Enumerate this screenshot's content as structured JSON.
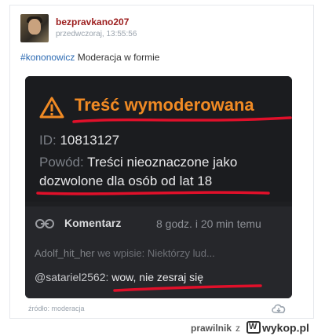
{
  "post": {
    "username": "bezpravkano207",
    "timestamp": "przedwczoraj, 13:55:56",
    "hash": "#",
    "tag": "kononowicz",
    "text": " Moderacja w formie"
  },
  "embed": {
    "title": "Treść wymoderowana",
    "id_label": "ID: ",
    "id_value": "10813127",
    "reason_label": "Powód: ",
    "reason_value_line1": "Treści nieoznaczone jako",
    "reason_value_line2": "dozwolone dla osób od lat 18",
    "comment_label": "Komentarz",
    "comment_time": "8 godz. i 20 min temu",
    "faded_user": "Adolf_hit_her",
    "faded_text": " we wpisie: Niektórzy lud...",
    "mention": "@satariel2562:",
    "comment_text": " wow, nie zesraj się",
    "accent_color": "#f08a24",
    "underline_color": "#e0102a"
  },
  "source": "źródło: moderacja",
  "footer": {
    "user": "prawilnik",
    "z": "z",
    "brand": "wykop.pl"
  },
  "icons": {
    "warning": "warning-triangle-icon",
    "link": "link-icon",
    "cloud": "cloud-download-icon",
    "logo": "wykop-logo-icon"
  }
}
